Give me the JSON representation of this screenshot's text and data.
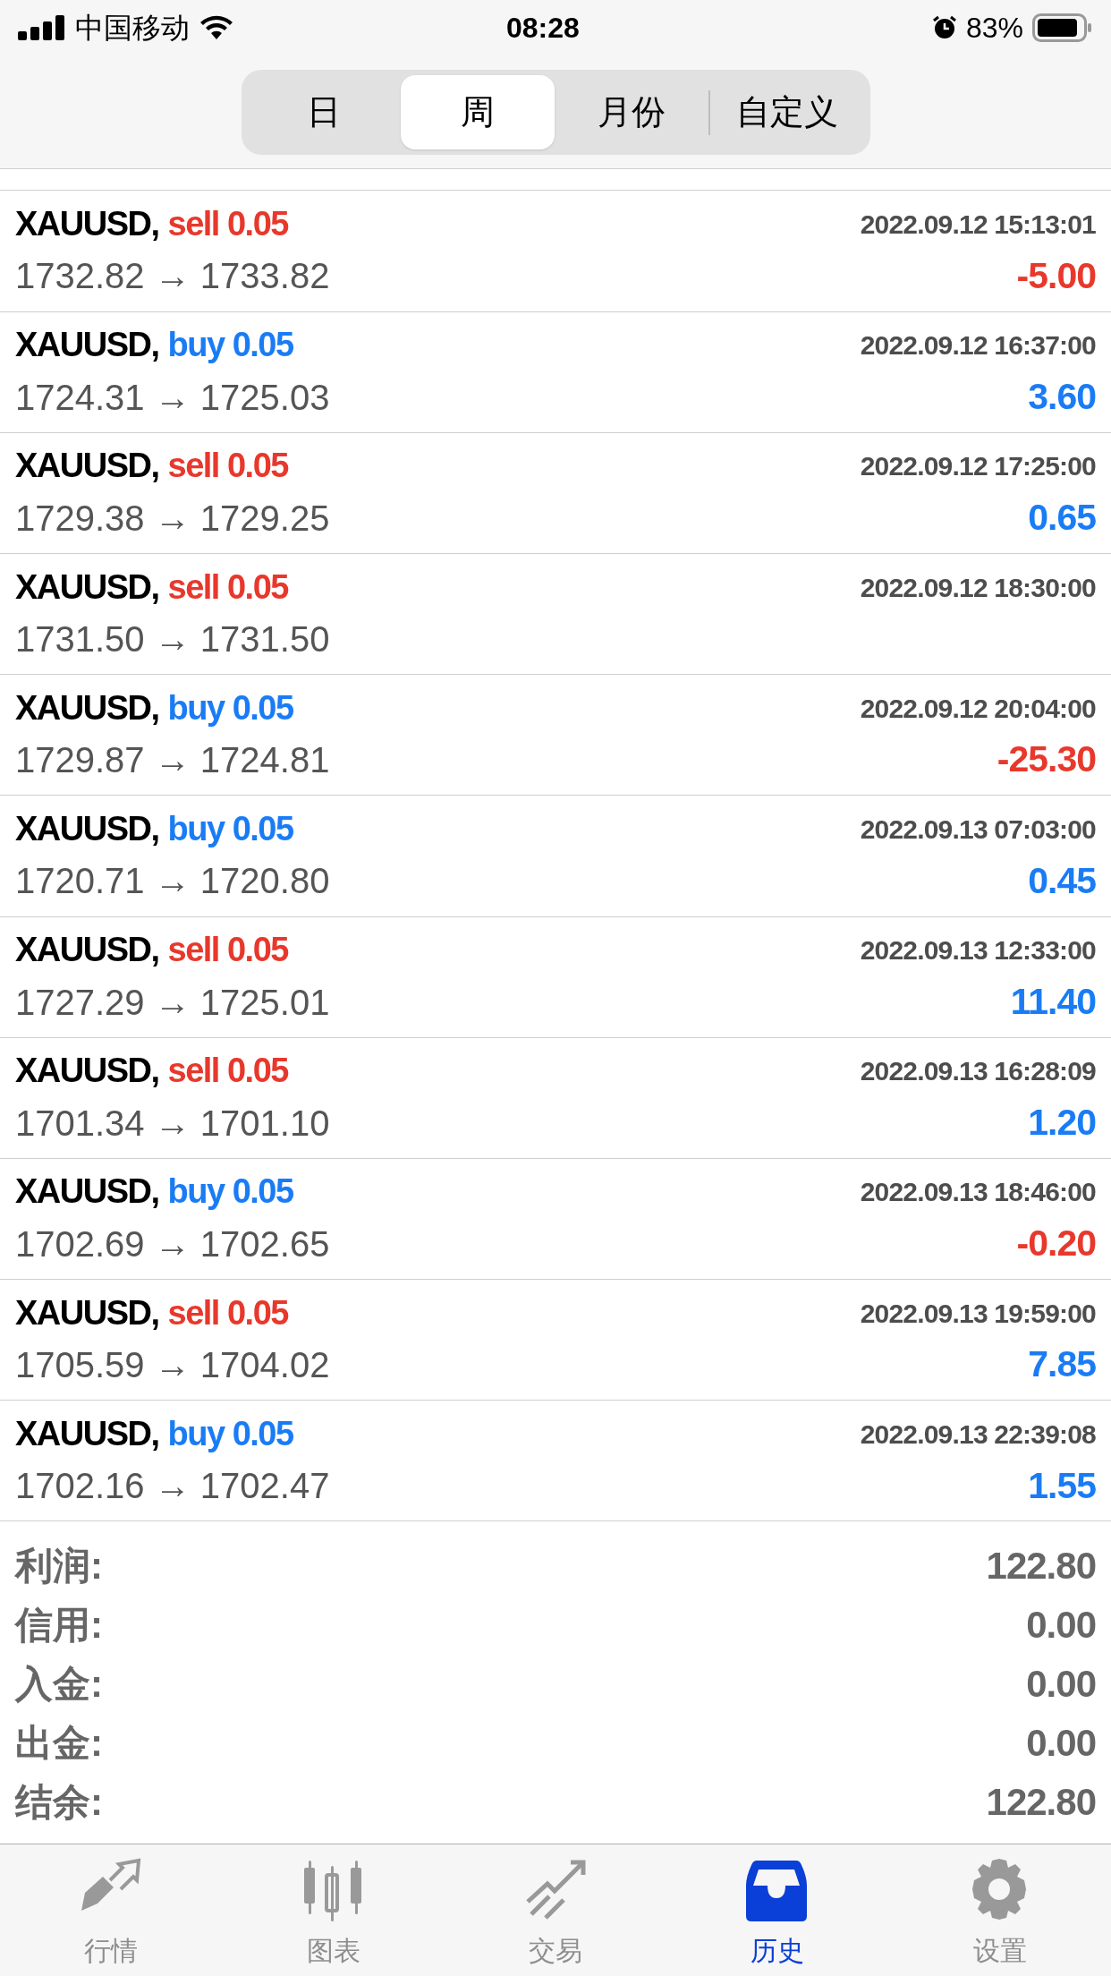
{
  "status_bar": {
    "carrier": "中国移动",
    "time": "08:28",
    "battery": "83%"
  },
  "period_tabs": [
    {
      "label": "日",
      "selected": false
    },
    {
      "label": "周",
      "selected": true
    },
    {
      "label": "月份",
      "selected": false
    },
    {
      "label": "自定义",
      "selected": false
    }
  ],
  "trades": [
    {
      "symbol": "XAUUSD,",
      "kind": "sell",
      "order": "sell 0.05",
      "time": "2022.09.12 15:13:01",
      "prices": "1732.82 → 1733.82",
      "profit": "-5.00",
      "loss": true
    },
    {
      "symbol": "XAUUSD,",
      "kind": "buy",
      "order": "buy 0.05",
      "time": "2022.09.12 16:37:00",
      "prices": "1724.31 → 1725.03",
      "profit": "3.60",
      "loss": false
    },
    {
      "symbol": "XAUUSD,",
      "kind": "sell",
      "order": "sell 0.05",
      "time": "2022.09.12 17:25:00",
      "prices": "1729.38 → 1729.25",
      "profit": "0.65",
      "loss": false
    },
    {
      "symbol": "XAUUSD,",
      "kind": "sell",
      "order": "sell 0.05",
      "time": "2022.09.12 18:30:00",
      "prices": "1731.50 → 1731.50"
    },
    {
      "symbol": "XAUUSD,",
      "kind": "buy",
      "order": "buy 0.05",
      "time": "2022.09.12 20:04:00",
      "prices": "1729.87 → 1724.81",
      "profit": "-25.30",
      "loss": true
    },
    {
      "symbol": "XAUUSD,",
      "kind": "buy",
      "order": "buy 0.05",
      "time": "2022.09.13 07:03:00",
      "prices": "1720.71 → 1720.80",
      "profit": "0.45",
      "loss": false
    },
    {
      "symbol": "XAUUSD,",
      "kind": "sell",
      "order": "sell 0.05",
      "time": "2022.09.13 12:33:00",
      "prices": "1727.29 → 1725.01",
      "profit": "11.40",
      "loss": false
    },
    {
      "symbol": "XAUUSD,",
      "kind": "sell",
      "order": "sell 0.05",
      "time": "2022.09.13 16:28:09",
      "prices": "1701.34 → 1701.10",
      "profit": "1.20",
      "loss": false
    },
    {
      "symbol": "XAUUSD,",
      "kind": "buy",
      "order": "buy 0.05",
      "time": "2022.09.13 18:46:00",
      "prices": "1702.69 → 1702.65",
      "profit": "-0.20",
      "loss": true
    },
    {
      "symbol": "XAUUSD,",
      "kind": "sell",
      "order": "sell 0.05",
      "time": "2022.09.13 19:59:00",
      "prices": "1705.59 → 1704.02",
      "profit": "7.85",
      "loss": false
    },
    {
      "symbol": "XAUUSD,",
      "kind": "buy",
      "order": "buy 0.05",
      "time": "2022.09.13 22:39:08",
      "prices": "1702.16 → 1702.47",
      "profit": "1.55",
      "loss": false
    }
  ],
  "summary": [
    {
      "label": "利润:",
      "value": "122.80"
    },
    {
      "label": "信用:",
      "value": "0.00"
    },
    {
      "label": "入金:",
      "value": "0.00"
    },
    {
      "label": "出金:",
      "value": "0.00"
    },
    {
      "label": "结余:",
      "value": "122.80"
    }
  ],
  "tab_bar": [
    {
      "kind": "quotes",
      "label": "行情",
      "selected": false
    },
    {
      "kind": "chart",
      "label": "图表",
      "selected": false
    },
    {
      "kind": "trade",
      "label": "交易",
      "selected": false
    },
    {
      "kind": "history",
      "label": "历史",
      "selected": true
    },
    {
      "kind": "settings",
      "label": "设置",
      "selected": false
    }
  ]
}
